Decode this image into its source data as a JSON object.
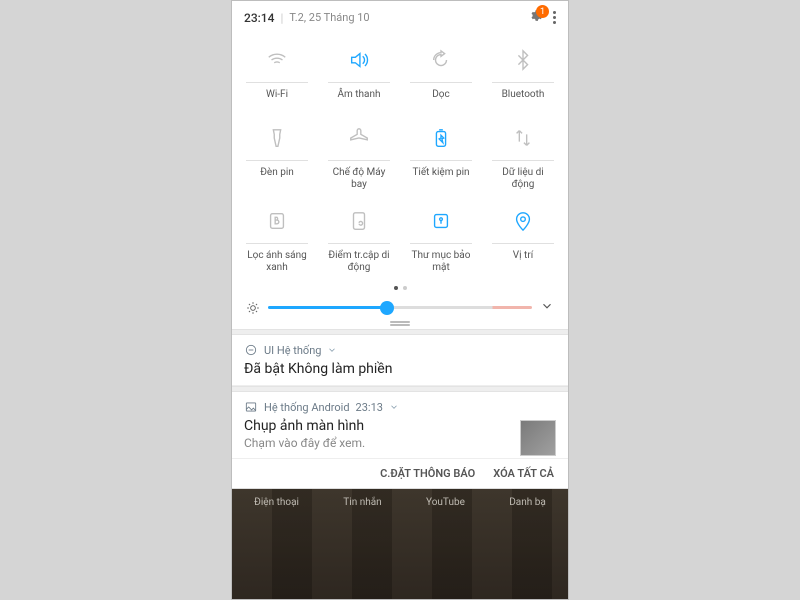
{
  "status": {
    "time": "23:14",
    "date": "T.2, 25 Tháng 10",
    "badge": "1"
  },
  "tiles": [
    {
      "label": "Wi-Fi",
      "active": false,
      "icon": "wifi"
    },
    {
      "label": "Âm thanh",
      "active": true,
      "icon": "sound"
    },
    {
      "label": "Dọc",
      "active": false,
      "icon": "rotate"
    },
    {
      "label": "Bluetooth",
      "active": false,
      "icon": "bt"
    },
    {
      "label": "Đèn pin",
      "active": false,
      "icon": "torch"
    },
    {
      "label": "Chế độ Máy bay",
      "active": false,
      "icon": "plane"
    },
    {
      "label": "Tiết kiệm pin",
      "active": true,
      "icon": "battery"
    },
    {
      "label": "Dữ liệu di động",
      "active": false,
      "icon": "data"
    },
    {
      "label": "Lọc ánh sáng xanh",
      "active": false,
      "icon": "blf"
    },
    {
      "label": "Điểm tr.cập di động",
      "active": false,
      "icon": "hotspot"
    },
    {
      "label": "Thư mục bảo mật",
      "active": true,
      "icon": "secure"
    },
    {
      "label": "Vị trí",
      "active": true,
      "icon": "location"
    }
  ],
  "notif1": {
    "app": "UI Hệ thống",
    "title": "Đã bật Không làm phiền"
  },
  "notif2": {
    "app": "Hệ thống Android",
    "time": "23:13",
    "title": "Chụp ảnh màn hình",
    "body": "Chạm vào đây để xem."
  },
  "actions": {
    "settings": "C.ĐẶT THÔNG BÁO",
    "clear": "XÓA TẤT CẢ"
  },
  "apps": [
    "Điện thoại",
    "Tin nhắn",
    "YouTube",
    "Danh bạ"
  ]
}
